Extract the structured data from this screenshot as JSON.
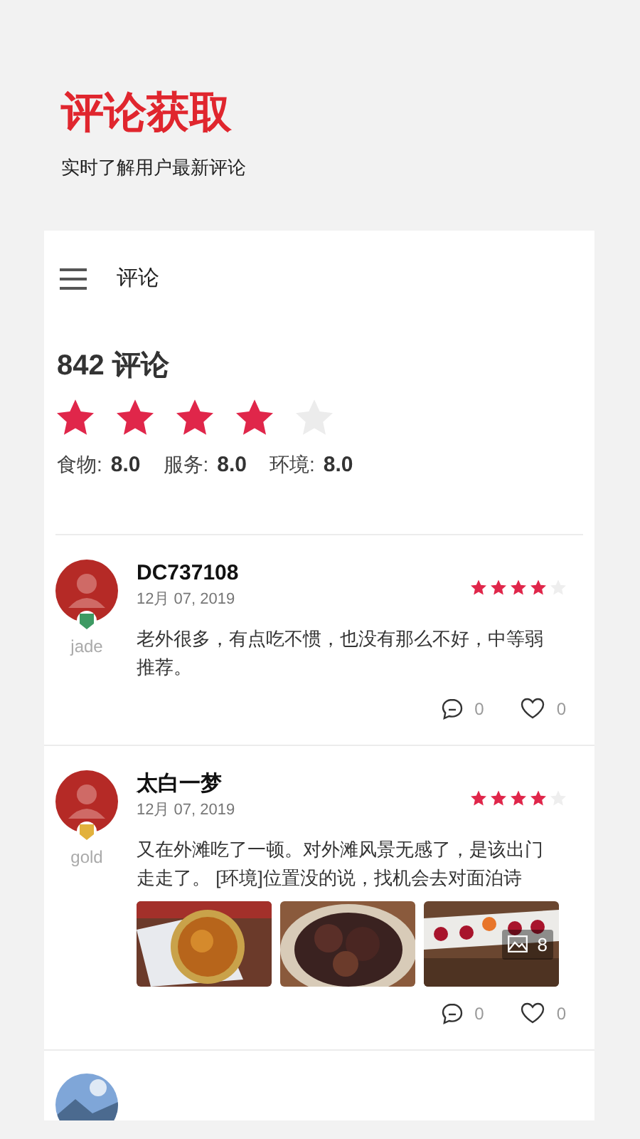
{
  "header": {
    "title": "评论获取",
    "subtitle": "实时了解用户最新评论"
  },
  "toolbar": {
    "title": "评论"
  },
  "summary": {
    "count": "842 评论",
    "stars": 4,
    "scores": [
      {
        "label": "食物:",
        "value": "8.0"
      },
      {
        "label": "服务:",
        "value": "8.0"
      },
      {
        "label": "环境:",
        "value": "8.0"
      }
    ]
  },
  "reviews": [
    {
      "name": "DC737108",
      "date": "12月 07, 2019",
      "level": "jade",
      "color": "#3e9a63",
      "stars": 4,
      "text": "老外很多，有点吃不惯，也没有那么不好，中等弱推荐。",
      "comments": "0",
      "likes": "0"
    },
    {
      "name": "太白一梦",
      "date": "12月 07, 2019",
      "level": "gold",
      "color": "#e2b13c",
      "stars": 4,
      "text": "又在外滩吃了一顿。对外滩风景无感了，是该出门走走了。 [环境]位置没的说，找机会去对面泊诗",
      "images": [
        {
          "kind": "picture"
        },
        {
          "kind": "picture"
        },
        {
          "kind": "picture"
        }
      ],
      "more_images": "8",
      "comments": "0",
      "likes": "0"
    }
  ]
}
